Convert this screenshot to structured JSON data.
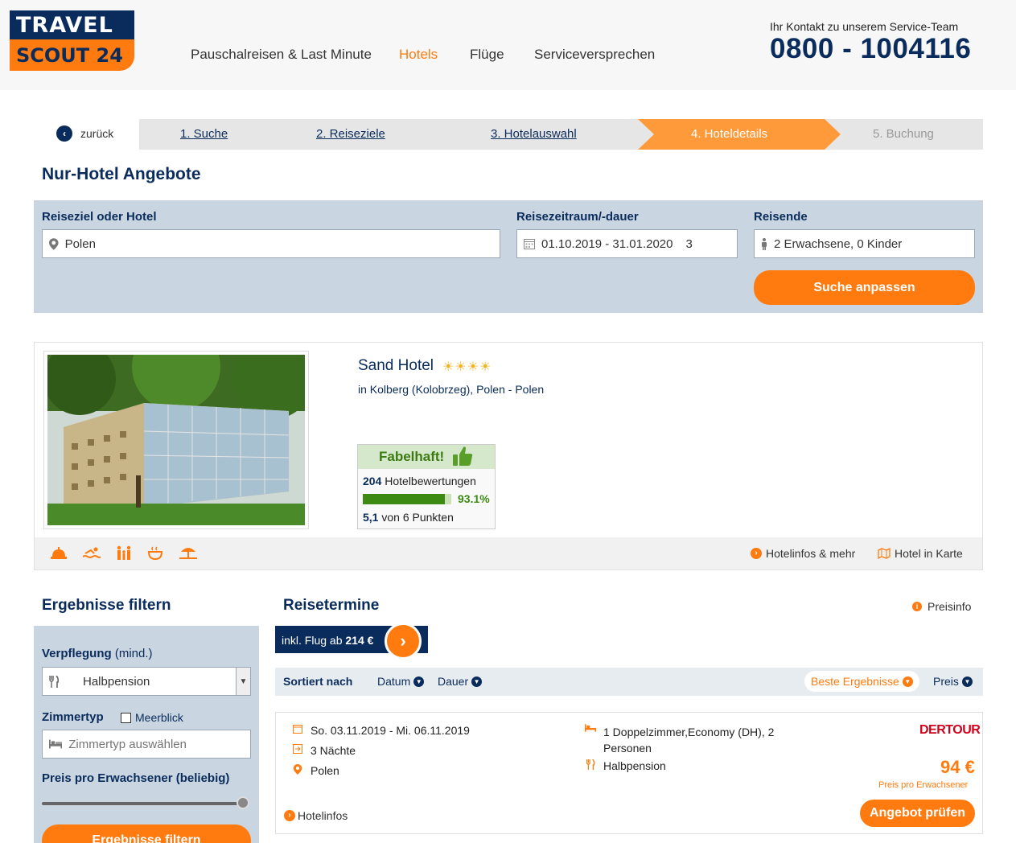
{
  "logo": {
    "line1": "TRAVEL",
    "line2": "SCOUT 24"
  },
  "nav": [
    {
      "label": "Pauschalreisen & Last Minute"
    },
    {
      "label": "Hotels"
    },
    {
      "label": "Flüge"
    },
    {
      "label": "Serviceversprechen"
    }
  ],
  "contact": {
    "label": "Ihr Kontakt zu unserem Service-Team",
    "phone": "0800 - 1004116"
  },
  "steps": {
    "back": "zurück",
    "items": [
      "1. Suche",
      "2. Reiseziele",
      "3. Hotelauswahl",
      "4. Hoteldetails",
      "5. Buchung"
    ]
  },
  "page_title": "Nur-Hotel Angebote",
  "search": {
    "dest_label": "Reiseziel oder Hotel",
    "dest_value": "Polen",
    "period_label": "Reisezeitraum/-dauer",
    "period_value": "01.10.2019 - 31.01.2020",
    "period_nights": "3",
    "travelers_label": "Reisende",
    "travelers_value": "2 Erwachsene, 0 Kinder",
    "submit": "Suche anpassen"
  },
  "hotel": {
    "name": "Sand Hotel",
    "stars": "☀☀☀☀",
    "star_count": 4,
    "location": "in Kolberg (Kolobrzeg), Polen - Polen",
    "rating": {
      "label": "Fabelhaft!",
      "reviews_count": "204",
      "reviews_text": "Hotelbewertungen",
      "percent": "93.1%",
      "percent_value": 93.1,
      "points": "5,1",
      "points_text": "von 6 Punkten"
    },
    "links": {
      "infos": "Hotelinfos & mehr",
      "map": "Hotel in Karte"
    },
    "amenities": [
      "reception-icon",
      "swimming-icon",
      "family-icon",
      "wellness-icon",
      "beach-icon"
    ]
  },
  "filter": {
    "title": "Ergebnisse filtern",
    "board_label": "Verpflegung",
    "board_min": "(mind.)",
    "board_value": "Halbpension",
    "room_label": "Zimmertyp",
    "seaview": "Meerblick",
    "room_placeholder": "Zimmertyp auswählen",
    "price_label": "Preis pro Erwachsener",
    "price_range": "(beliebig)",
    "submit": "Ergebnisse filtern"
  },
  "results": {
    "title": "Reisetermine",
    "preisinfo": "Preisinfo",
    "flight_prefix": "inkl. Flug ab",
    "flight_price": "214 €",
    "sort_label": "Sortiert nach",
    "sort_options": [
      "Datum",
      "Dauer",
      "Beste Ergebnisse",
      "Preis"
    ]
  },
  "offer": {
    "dates": "So. 03.11.2019 - Mi. 06.11.2019",
    "nights": "3 Nächte",
    "destination": "Polen",
    "room_line1": "1 Doppelzimmer,Economy (DH), 2",
    "room_line2": "Personen",
    "board": "Halbpension",
    "operator": "DERTOUR",
    "price": "94 €",
    "price_note": "Preis pro Erwachsener",
    "cta": "Angebot prüfen",
    "hotelinfos": "Hotelinfos"
  }
}
